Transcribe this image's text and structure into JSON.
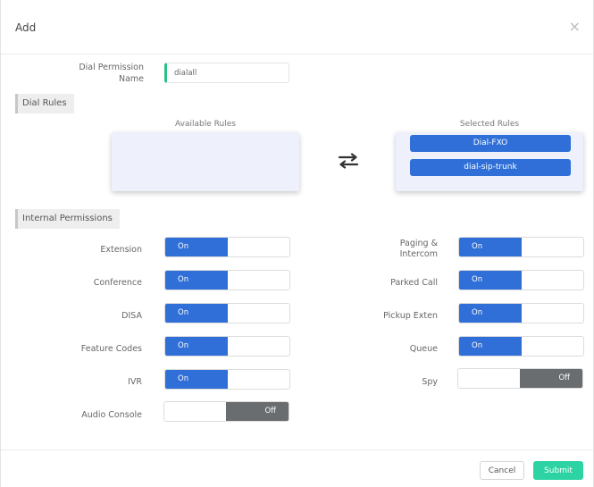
{
  "dialog": {
    "title": "Add",
    "close_icon": "×"
  },
  "dial_permission": {
    "label_line1": "Dial Permission",
    "label_line2": "Name",
    "value": "dialall",
    "accent": "#26c281"
  },
  "sections": {
    "dial_rules": "Dial Rules",
    "internal_permissions": "Internal Permissions"
  },
  "rules": {
    "available_label": "Available Rules",
    "selected_label": "Selected Rules",
    "available": [],
    "selected": [
      "Dial-FXO",
      "dial-sip-trunk"
    ],
    "transfer_icon": "transfer-arrows-icon"
  },
  "permissions": {
    "left": [
      {
        "label": "Extension",
        "state": "On"
      },
      {
        "label": "Conference",
        "state": "On"
      },
      {
        "label": "DISA",
        "state": "On"
      },
      {
        "label": "Feature Codes",
        "state": "On"
      },
      {
        "label": "IVR",
        "state": "On"
      },
      {
        "label": "Audio Console",
        "state": "Off"
      }
    ],
    "right": [
      {
        "label_line1": "Paging &",
        "label_line2": "Intercom",
        "state": "On"
      },
      {
        "label": "Parked Call",
        "state": "On"
      },
      {
        "label": "Pickup Exten",
        "state": "On"
      },
      {
        "label": "Queue",
        "state": "On"
      },
      {
        "label": "Spy",
        "state": "Off"
      }
    ]
  },
  "footer": {
    "cancel_label": "Cancel",
    "submit_label": "Submit"
  },
  "colors": {
    "primary": "#2f6fd7",
    "submit": "#2ed3a3",
    "off": "#6a6d70"
  }
}
